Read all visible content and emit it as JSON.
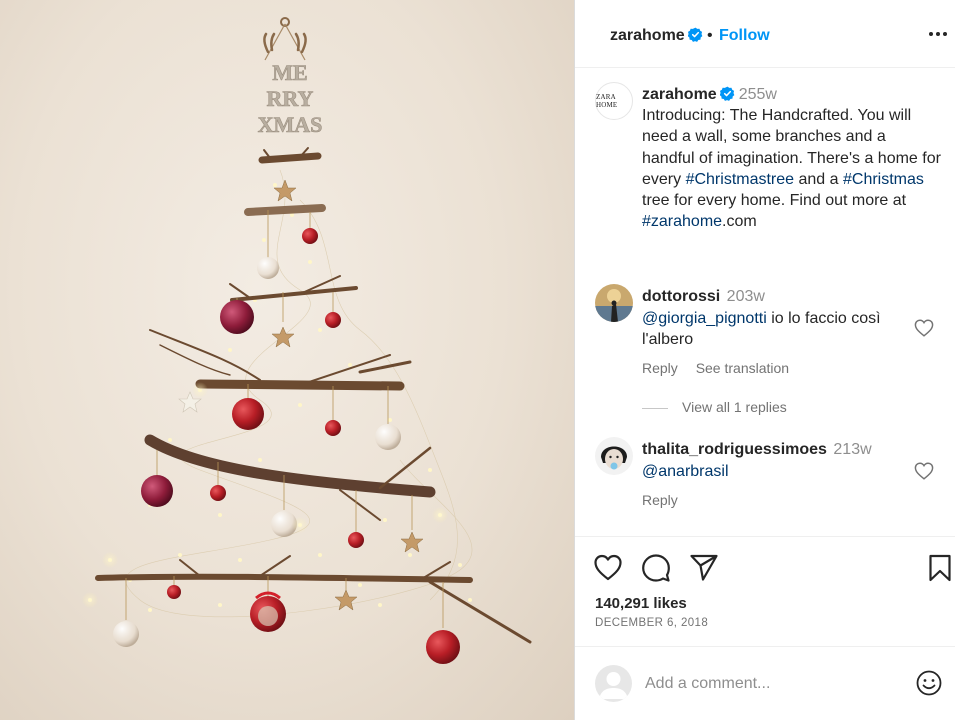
{
  "post": {
    "sign_text_1": "ME",
    "sign_text_2": "RRY",
    "sign_text_3": "XMAS"
  },
  "header": {
    "username": "zarahome",
    "verified": true,
    "separator": "•",
    "follow_label": "Follow",
    "more_icon": "more-horizontal-icon"
  },
  "caption": {
    "avatar_text": "ZARA HOME",
    "username": "zarahome",
    "time": "255w",
    "text_1": "Introducing: The Handcrafted. You will need a wall, some branches and a handful of imagination. There's a home for every ",
    "hashtag_1": "#Christmastree",
    "text_2": " and a ",
    "hashtag_2": "#Christmas",
    "text_3": " tree for every home. Find out more at ",
    "hashtag_3": "#zarahome",
    "text_4": ".com"
  },
  "comments": [
    {
      "username": "dottorossi",
      "time": "203w",
      "mention": "@giorgia_pignotti",
      "text": " io lo faccio così l'albero",
      "reply_label": "Reply",
      "translate_label": "See translation",
      "view_replies_label": "View all 1 replies"
    },
    {
      "username": "thalita_rodriguessimoes",
      "time": "213w",
      "mention": "@anarbrasil",
      "text": "",
      "reply_label": "Reply"
    }
  ],
  "actions": {
    "like_icon": "heart-icon",
    "comment_icon": "comment-icon",
    "share_icon": "send-icon",
    "save_icon": "bookmark-icon",
    "likes": "140,291 likes",
    "date": "DECEMBER 6, 2018"
  },
  "add_comment": {
    "placeholder": "Add a comment...",
    "emoji_icon": "emoji-icon"
  },
  "colors": {
    "link": "#0095f6",
    "hashtag": "#00376b",
    "verified": "#0095f6",
    "secondary_text": "#737373"
  }
}
